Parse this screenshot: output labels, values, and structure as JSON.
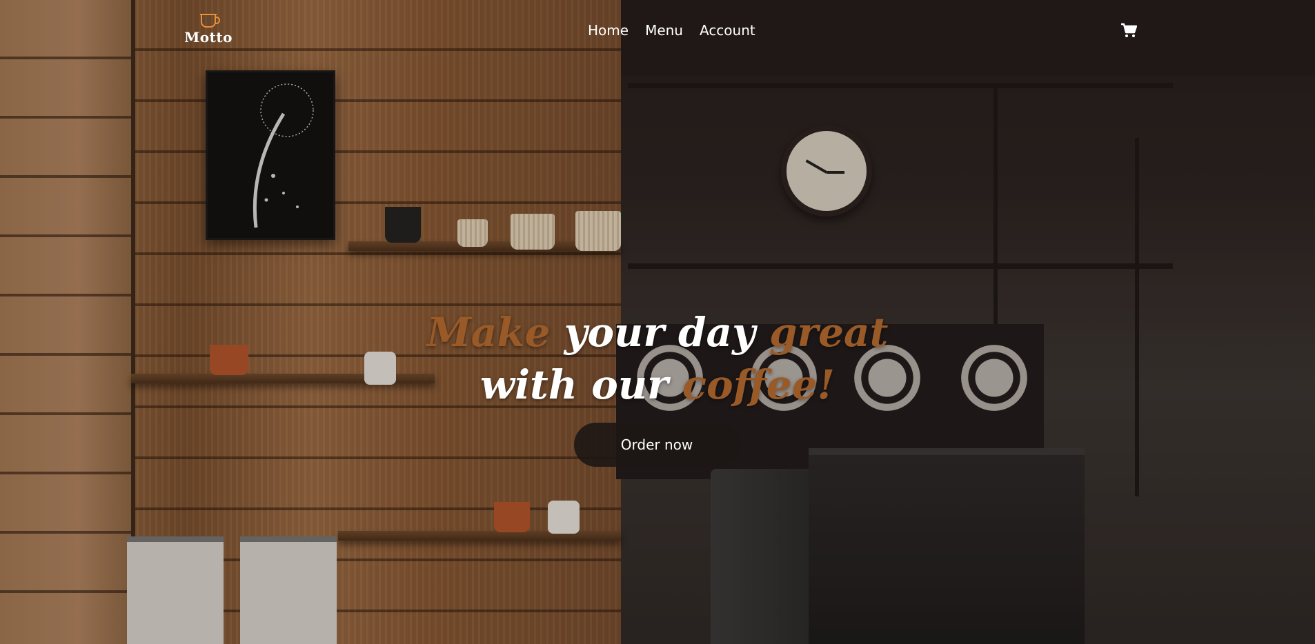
{
  "header": {
    "logo_text": "Motto",
    "logo_icon": "coffee-cup-icon",
    "nav": [
      {
        "label": "Home"
      },
      {
        "label": "Menu"
      },
      {
        "label": "Account"
      }
    ],
    "cart_icon": "cart-icon"
  },
  "hero": {
    "line1_part1": "Make",
    "line1_part2": " your day ",
    "line1_part3": "great",
    "line2_part1": "with our ",
    "line2_part2": "coffee!",
    "cta_label": "Order now"
  },
  "colors": {
    "accent": "#e8913b",
    "title_accent": "#9a5a28",
    "button_bg": "#1c1614",
    "text": "#ffffff"
  }
}
